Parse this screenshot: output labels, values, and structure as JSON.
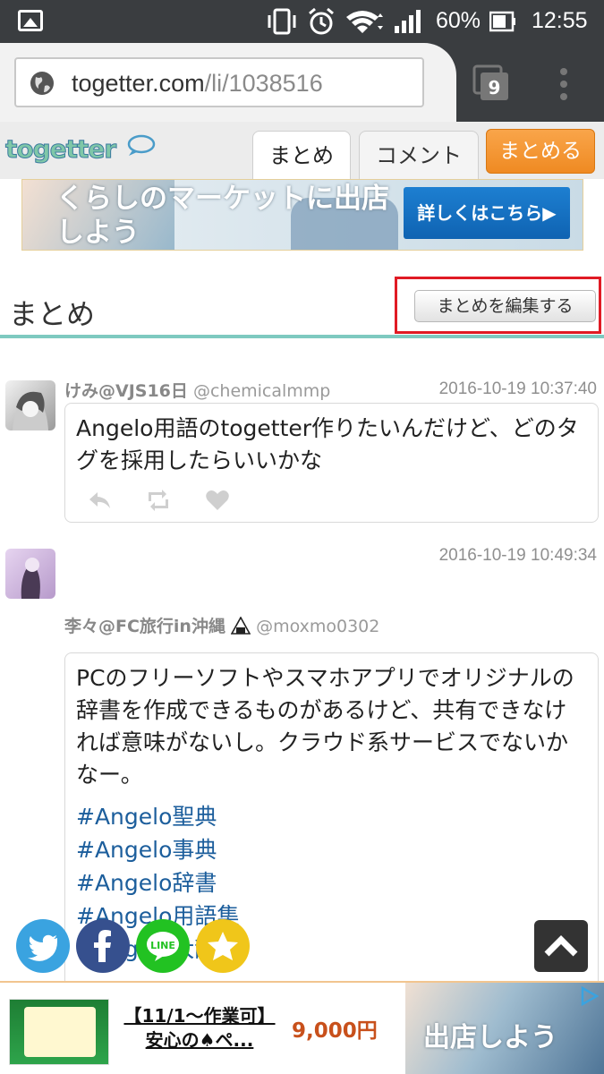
{
  "status_bar": {
    "battery_percent": "60%",
    "time": "12:55"
  },
  "browser": {
    "url_host": "togetter.com",
    "url_path": "/li/1038516",
    "tab_count": "9"
  },
  "site": {
    "logo_text": "togetter",
    "tabs": [
      {
        "label": "まとめ",
        "active": true
      },
      {
        "label": "コメント",
        "active": false
      }
    ],
    "create_button": "まとめる"
  },
  "ad_top": {
    "headline": "くらしのマーケットに出店しよう",
    "button": "詳しくはこちら▶"
  },
  "section": {
    "title": "まとめ",
    "edit_button": "まとめを編集する"
  },
  "tweets": [
    {
      "name": "けみ@VJS16日",
      "handle": "@chemicalmmp",
      "time": "2016-10-19 10:37:40",
      "text": "Angelo用語のtogetter作りたいんだけど、どのタグを採用したらいいかな"
    },
    {
      "name": "李々@FC旅行in沖縄",
      "handle": "@moxmo0302",
      "time": "2016-10-19 10:49:34",
      "text": "PCのフリーソフトやスマホアプリでオリジナルの辞書を作成できるものがあるけど、共有できなければ意味がないし。クラウド系サービスでないかなー。",
      "tags": [
        "#Angelo聖典",
        "#Angelo事典",
        "#Angelo辞書",
        "#Angelo用語集",
        "#Angelo大辞典"
      ]
    }
  ],
  "ad_bottom": {
    "title": "【11/1～作業可】安心の♠ペ...",
    "price": "9,000円",
    "image_text": "出店しよう"
  },
  "icons": {
    "share": [
      "twitter-icon",
      "facebook-icon",
      "line-icon",
      "favorite-star-icon"
    ],
    "scroll_top": "chevron-up-icon"
  },
  "colors": {
    "accent_teal": "#7ec9c0",
    "create_orange": "#ef8a22",
    "highlight_red": "#e01b24",
    "hashtag_blue": "#1c5e9c"
  }
}
